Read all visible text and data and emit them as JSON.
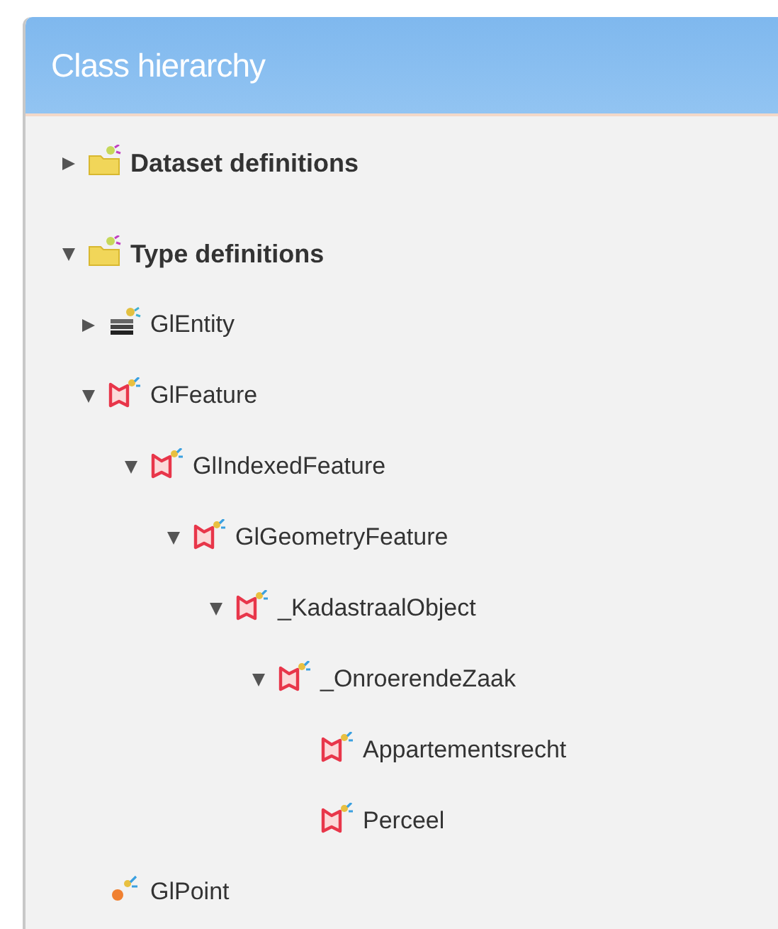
{
  "panel": {
    "title": "Class hierarchy"
  },
  "tree": [
    {
      "label": "Dataset definitions",
      "kind": "folder",
      "expanded": false
    },
    {
      "label": "Type definitions",
      "kind": "folder",
      "expanded": true,
      "children": [
        {
          "label": "GlEntity",
          "kind": "entity",
          "expanded": false
        },
        {
          "label": "GlFeature",
          "kind": "feature",
          "expanded": true,
          "children": [
            {
              "label": "GlIndexedFeature",
              "kind": "feature",
              "expanded": true,
              "children": [
                {
                  "label": "GlGeometryFeature",
                  "kind": "feature",
                  "expanded": true,
                  "children": [
                    {
                      "label": "_KadastraalObject",
                      "kind": "feature",
                      "expanded": true,
                      "children": [
                        {
                          "label": "_OnroerendeZaak",
                          "kind": "feature",
                          "expanded": true,
                          "children": [
                            {
                              "label": "Appartementsrecht",
                              "kind": "feature"
                            },
                            {
                              "label": "Perceel",
                              "kind": "feature"
                            }
                          ]
                        }
                      ]
                    }
                  ]
                }
              ]
            }
          ]
        },
        {
          "label": "GlPoint",
          "kind": "point"
        }
      ]
    }
  ]
}
